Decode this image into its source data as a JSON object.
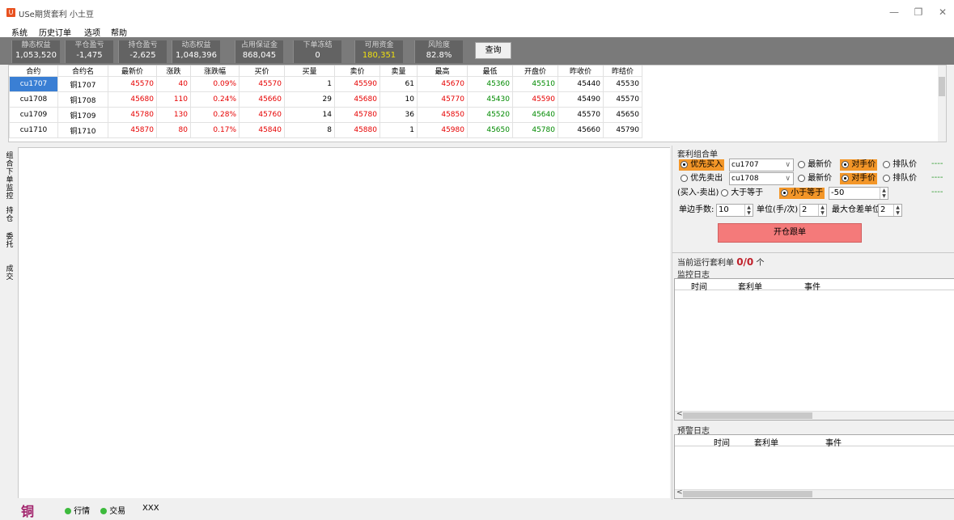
{
  "window": {
    "icon_text": "U",
    "title": "USe期货套利 小土豆",
    "controls": [
      "—",
      "❐",
      "✕"
    ]
  },
  "menu": [
    "系统",
    "历史订单",
    "选项",
    "帮助"
  ],
  "stats": [
    {
      "label": "静态权益",
      "value": "1,053,520"
    },
    {
      "label": "平仓盈亏",
      "value": "-1,475"
    },
    {
      "label": "持仓盈亏",
      "value": "-2,625"
    },
    {
      "label": "动态权益",
      "value": "1,048,396"
    },
    {
      "label": "占用保证金",
      "value": "868,045"
    },
    {
      "label": "下单冻结",
      "value": "0"
    },
    {
      "label": "可用资金",
      "value": "180,351"
    },
    {
      "label": "风险度",
      "value": "82.8%"
    }
  ],
  "query_button": "查询",
  "quotes": {
    "headers": [
      "合约",
      "合约名",
      "最新价",
      "涨跌",
      "涨跌幅",
      "买价",
      "买量",
      "卖价",
      "卖量",
      "最高",
      "最低",
      "开盘价",
      "昨收价",
      "昨结价"
    ],
    "rows": [
      [
        "cu1707",
        "铜1707",
        "45570",
        "40",
        "0.09%",
        "45570",
        "1",
        "45590",
        "61",
        "45670",
        "45360",
        "45510",
        "45440",
        "45530"
      ],
      [
        "cu1708",
        "铜1708",
        "45680",
        "110",
        "0.24%",
        "45660",
        "29",
        "45680",
        "10",
        "45770",
        "45430",
        "45590",
        "45490",
        "45570"
      ],
      [
        "cu1709",
        "铜1709",
        "45780",
        "130",
        "0.28%",
        "45760",
        "14",
        "45780",
        "36",
        "45850",
        "45520",
        "45640",
        "45570",
        "45650"
      ],
      [
        "cu1710",
        "铜1710",
        "45870",
        "80",
        "0.17%",
        "45840",
        "8",
        "45880",
        "1",
        "45980",
        "45650",
        "45780",
        "45660",
        "45790"
      ]
    ]
  },
  "left_tabs": [
    "组合下单监控",
    "持仓",
    "委托",
    "成交"
  ],
  "arb": {
    "title": "套利组合单",
    "buy_first": "优先买入",
    "sell_first": "优先卖出",
    "buy_contract": "cu1707",
    "sell_contract": "cu1708",
    "latest_price": "最新价",
    "counter_price": "对手价",
    "queue_price": "排队价",
    "spread_label": "(买入-卖出)价差",
    "gte": "大于等于",
    "lte": "小于等于",
    "spread_value": "-50",
    "lots_label": "单边手数:",
    "lots_value": "10",
    "unit_label": "单位(手/次)",
    "unit_value": "2",
    "max_label": "最大仓差单位",
    "max_value": "2",
    "dash": "----",
    "open_button": "开仓跟单"
  },
  "running": {
    "label": "当前运行套利单",
    "count": "0/0",
    "suffix": "个"
  },
  "monitor_log": {
    "title": "监控日志",
    "cols": [
      "时间",
      "套利单",
      "事件"
    ]
  },
  "alert_log": {
    "title": "预警日志",
    "cols": [
      "时间",
      "套利单",
      "事件"
    ]
  },
  "status": {
    "product": "铜",
    "market": "行情",
    "trade": "交易",
    "account": "XXX"
  },
  "colors": {
    "stats_bg": "#7a7a7a",
    "up": "#e60000",
    "down": "#008a00",
    "highlight": "#f39628",
    "open_button": "#f47a7a"
  }
}
